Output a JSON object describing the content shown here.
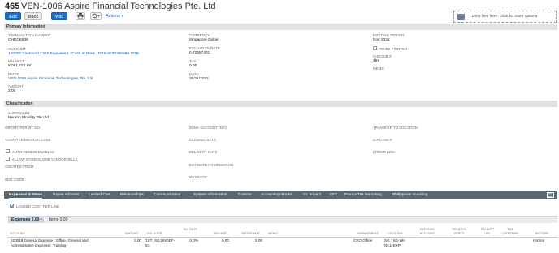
{
  "header": {
    "number": "465",
    "name": "VEN-1006 Aspire Financial Technologies Pte. Ltd"
  },
  "toolbar": {
    "edit_label": "Edit",
    "back_label": "Back",
    "void_label": "Void",
    "print_icon": "printer-icon",
    "more_icon": "gear-dropdown-icon",
    "actions_label": "Actions ▾"
  },
  "dropzone": {
    "text": "Drop files here. Click for more options."
  },
  "primary": {
    "title": "Primary Information",
    "transaction_number_label": "TRANSACTION NUMBER",
    "transaction_number_value": "CHECK836",
    "account_label": "ACCOUNT",
    "account_value": "100002 Cash and Cash Equivalent : Cash at Bank : DBS-0039395980-SGD",
    "balance_label": "BALANCE",
    "balance_value": "8,091,222.68",
    "payee_label": "PAYEE",
    "payee_value": "VEN-1006 Aspire Financial Technologies Pte. Ltd",
    "amount_label": "AMOUNT",
    "amount_value": "2.00",
    "currency_label": "CURRENCY",
    "currency_value": "Singapore Dollar",
    "exchange_rate_label": "EXCHANGE RATE",
    "exchange_rate_value": "0.72697401",
    "tax_label": "TAX",
    "tax_value": "0.00",
    "date_label": "DATE",
    "date_value": "30/11/2022",
    "posting_period_label": "POSTING PERIOD",
    "posting_period_value": "Nov 2022",
    "to_be_printed_label": "TO BE PRINTED",
    "cheque_label": "CHEQUE #",
    "cheque_value": "465",
    "memo_label": "MEMO"
  },
  "classification": {
    "title": "Classification",
    "subsidiary_label": "SUBSIDIARY",
    "subsidiary_value": "Neuron Mobility Pte Ltd",
    "import_permit_label": "IMPORT PERMIT NO.",
    "taxpayer_branch_label": "TAXPAYER BRANCH CODE",
    "auto_renew_label": "AUTO-RENEW ENABLED",
    "allow_standalone_label": "ALLOW STANDALONE VENDOR BILLS",
    "created_from_label": "CREATED FROM",
    "ddr_code_label": "DDR CODE",
    "bank_account_info_label": "BANK ACCOUNT INFO",
    "closing_date_label": "CLOSING DATE",
    "delivery_date_label": "DELIVERY DATE",
    "estimate_info_label": "ESTIMATE INFORMATION",
    "message_label": "MESSAGE",
    "transfer_location_label": "TRANSFER TO LOCATION",
    "icpo_ref_label": "ICPO REF#",
    "error_log_label": "ERROR LOG"
  },
  "tabs": [
    "Expenses & Items",
    "Payee Address",
    "Landed Cost",
    "Relationships",
    "Communication",
    "System Information",
    "Custom",
    "Accounting Books",
    "GL Impact",
    "EFT",
    "France Tax Reporting",
    "Philippines Invoicing"
  ],
  "landed_cost_label": "LANDED COST PER LINE",
  "subtabs": {
    "expenses": "Expenses 2.00 •",
    "items": "Items 0.00"
  },
  "table": {
    "headers": [
      "ACCOUNT",
      "AMOUNT",
      "TAX CODE",
      "TAX RATE",
      "TAX AMT",
      "GROSS AMT",
      "MEMO",
      "DEPARTMENT",
      "LOCATION",
      "EXPENSE ACCOUNT",
      "RELATED ASSET",
      "RECEIPT URL",
      "TAX CATEGORY",
      "HISTORY"
    ],
    "row": {
      "account": "520018 General Expense : Office, General and Administrative Expense : Training",
      "amount": "2.00",
      "tax_code": "GST_SG:UNDEF-SG",
      "tax_rate": "0.0%",
      "tax_amt": "0.00",
      "gross_amt": "2.00",
      "memo": "",
      "department": "CEO Office",
      "location": "SG : SG-UK-NCL-EXP",
      "history": "History"
    }
  },
  "colors": {
    "accent": "#1f6fc5",
    "tabbar": "#5b6770",
    "section": "#dfe3e8"
  }
}
